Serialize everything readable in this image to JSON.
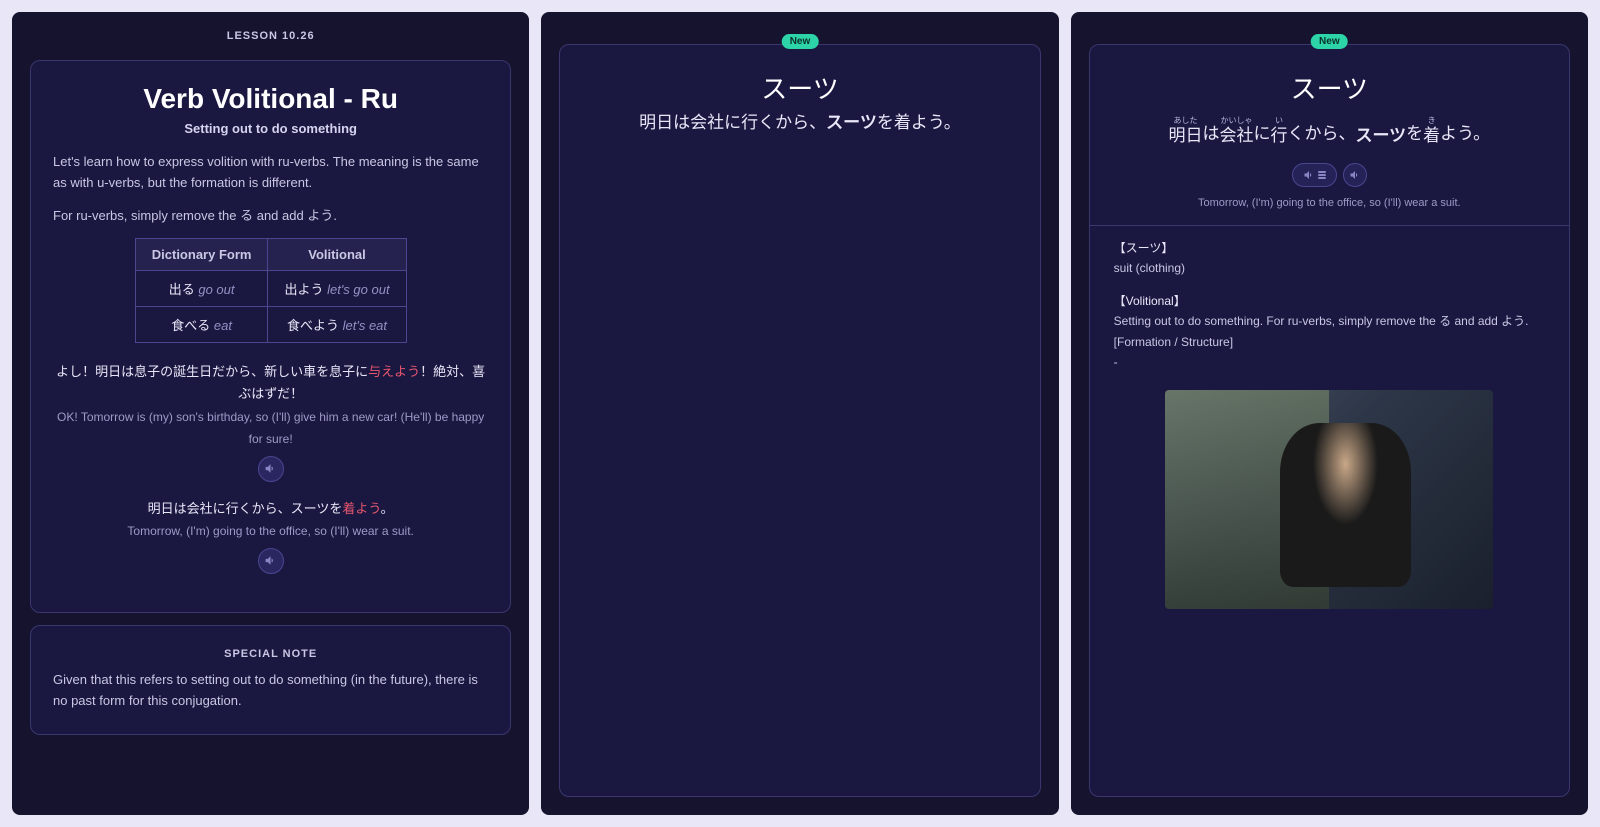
{
  "panel1": {
    "lesson_label": "LESSON 10.26",
    "title": "Verb Volitional - Ru",
    "subtitle": "Setting out to do something",
    "intro1": "Let's learn how to express volition with ru-verbs. The meaning is the same as with u-verbs, but the formation is different.",
    "intro2": "For ru-verbs, simply remove the る and add よう.",
    "table": {
      "headers": [
        "Dictionary Form",
        "Volitional"
      ],
      "rows": [
        {
          "dict": "出る",
          "dict_meaning": "go out",
          "vol": "出よう",
          "vol_meaning": "let's go out"
        },
        {
          "dict": "食べる",
          "dict_meaning": "eat",
          "vol": "食べよう",
          "vol_meaning": "let's eat"
        }
      ]
    },
    "ex1": {
      "jp_pre": "よし！明日は息子の誕生日だから、新しい車を息子に",
      "jp_hl": "与えよう",
      "jp_post": "！絶対、喜ぶはずだ！",
      "en": "OK! Tomorrow is (my) son's birthday, so (I'll) give him a new car! (He'll) be happy for sure!"
    },
    "ex2": {
      "jp_pre": "明日は会社に行くから、スーツを",
      "jp_hl": "着よう",
      "jp_post": "。",
      "en": "Tomorrow, (I'm) going to the office, so (I'll) wear a suit."
    },
    "note_label": "SPECIAL NOTE",
    "note_text": "Given that this refers to setting out to do something (in the future), there is no past form for this conjugation."
  },
  "panel2": {
    "badge": "New",
    "vocab": "スーツ",
    "sentence_pre": "明日は会社に行くから、",
    "sentence_bold": "スーツ",
    "sentence_post": "を着よう。"
  },
  "panel3": {
    "badge": "New",
    "vocab": "スーツ",
    "furigana_parts": [
      {
        "f": "あした",
        "k": "明日"
      },
      {
        "f": "",
        "k": "は"
      },
      {
        "f": "かいしゃ",
        "k": "会社"
      },
      {
        "f": "",
        "k": "に"
      },
      {
        "f": "い",
        "k": "行"
      },
      {
        "f": "",
        "k": "くから、"
      }
    ],
    "sentence_bold": "スーツ",
    "furigana_parts2": [
      {
        "f": "",
        "k": "を"
      },
      {
        "f": "き",
        "k": "着"
      },
      {
        "f": "",
        "k": "よう。"
      }
    ],
    "translation": "Tomorrow, (I'm) going to the office, so (I'll) wear a suit.",
    "def1_head": "【スーツ】",
    "def1_body": "suit (clothing)",
    "def2_head": "【Volitional】",
    "def2_body": "Setting out to do something. For ru-verbs, simply remove the る and add よう.",
    "def2_struct": "[Formation / Structure]",
    "def2_dash": "-"
  }
}
